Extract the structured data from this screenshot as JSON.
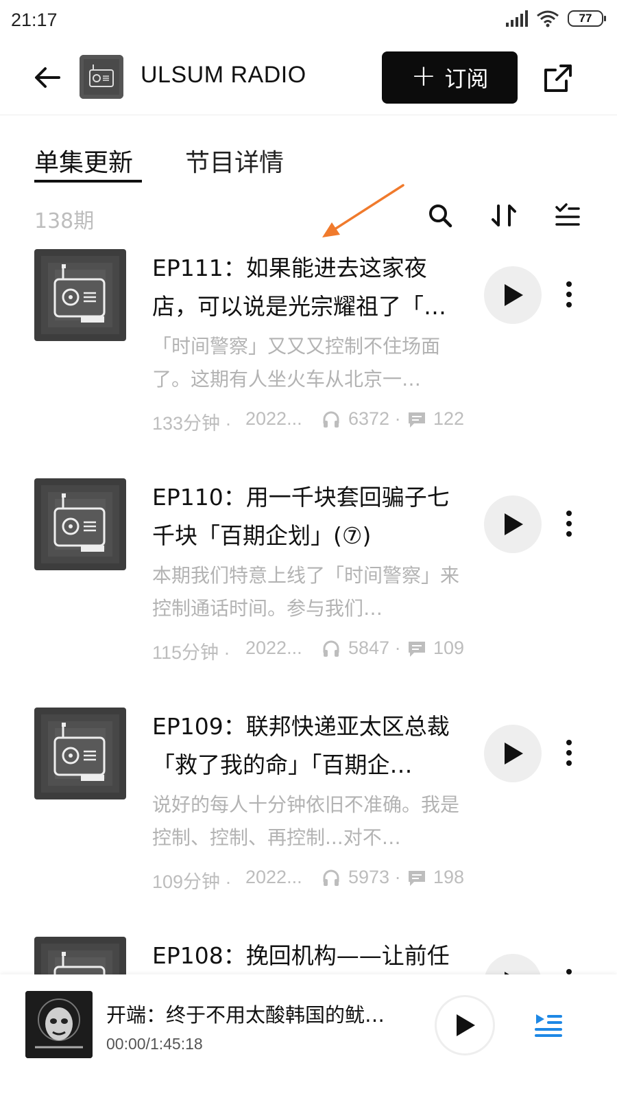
{
  "status_bar": {
    "time": "21:17",
    "battery": "77"
  },
  "header": {
    "channel_name": "ULSUM RADIO",
    "subscribe_label": "订阅"
  },
  "tabs": [
    {
      "label": "单集更新",
      "active": true
    },
    {
      "label": "节目详情",
      "active": false
    }
  ],
  "list": {
    "count": "138期"
  },
  "episodes": [
    {
      "title": "EP111：如果能进去这家夜店，可以说是光宗耀祖了「…",
      "description": "「时间警察」又又又控制不住场面了。这期有人坐火车从北京一…",
      "duration": "133分钟 ·",
      "date": "2022...",
      "plays": "6372 ·",
      "comments": "122"
    },
    {
      "title": "EP110：用一千块套回骗子七千块「百期企划」(⑦)",
      "description": "本期我们特意上线了「时间警察」来控制通话时间。参与我们…",
      "duration": "115分钟 ·",
      "date": "2022...",
      "plays": "5847 ·",
      "comments": "109"
    },
    {
      "title": "EP109：联邦快递亚太区总裁「救了我的命」「百期企…",
      "description": "说好的每人十分钟依旧不准确。我是控制、控制、再控制...对不…",
      "duration": "109分钟 ·",
      "date": "2022...",
      "plays": "5973 ·",
      "comments": "198"
    },
    {
      "title": "EP108：挽回机构——让前任",
      "description": "",
      "duration": "",
      "date": "",
      "plays": "",
      "comments": ""
    }
  ],
  "mini_player": {
    "title": "开端：终于不用太酸韩国的鱿…",
    "time": "00:00/1:45:18"
  },
  "colors": {
    "accent_dark": "#0c0c0c",
    "secondary_text": "#bdbdbd",
    "annotation_arrow": "#f07a2c"
  }
}
